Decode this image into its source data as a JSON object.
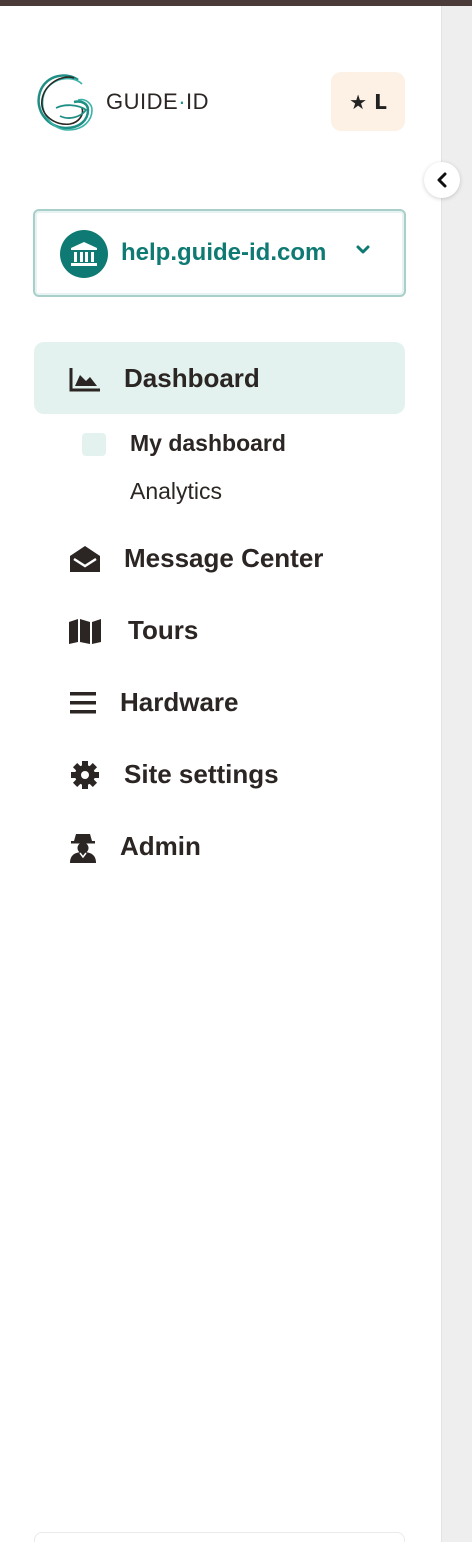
{
  "brand": {
    "name_left": "GUIDE",
    "name_dot": "·",
    "name_right": "ID",
    "accent_color": "#0f7a73"
  },
  "badge": {
    "label": "★ L"
  },
  "site_selector": {
    "label": "help.guide-id.com",
    "icon": "building-columns-icon",
    "chevron": "chevron-down-icon"
  },
  "nav": {
    "dashboard": {
      "label": "Dashboard",
      "icon": "chart-area-icon",
      "active": true
    },
    "dashboard_sub": [
      {
        "label": "My dashboard",
        "active": true
      },
      {
        "label": "Analytics",
        "active": false
      }
    ],
    "message_center": {
      "label": "Message Center",
      "icon": "envelope-open-icon"
    },
    "tours": {
      "label": "Tours",
      "icon": "map-icon"
    },
    "hardware": {
      "label": "Hardware",
      "icon": "bars-icon"
    },
    "site_settings": {
      "label": "Site settings",
      "icon": "gear-icon"
    },
    "admin": {
      "label": "Admin",
      "icon": "user-secret-icon"
    }
  },
  "collapse_button": {
    "icon": "chevron-left-icon"
  }
}
